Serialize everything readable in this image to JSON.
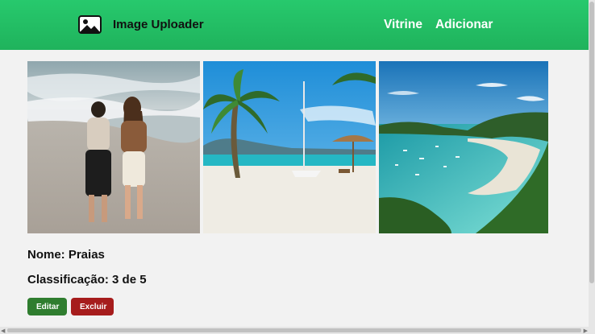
{
  "header": {
    "app_name": "Image Uploader",
    "brand_icon": "image-icon",
    "nav_links": [
      "Vitrine",
      "Adicionar"
    ]
  },
  "item": {
    "name_line": "Nome: Praias",
    "rating_line": "Classificação: 3 de 5",
    "rating_value": 3,
    "rating_max": 5,
    "photos": [
      {
        "subject": "couple walking on beach shoreline"
      },
      {
        "subject": "palm tree and umbrella on white sand beach"
      },
      {
        "subject": "aerial view of turquoise bay with boats"
      }
    ]
  },
  "actions": {
    "edit_label": "Editar",
    "delete_label": "Excluir"
  },
  "colors": {
    "navbar": "#22c064",
    "edit_button": "#2f7d2f",
    "delete_button": "#a61c1c",
    "background": "#f2f2f2"
  }
}
